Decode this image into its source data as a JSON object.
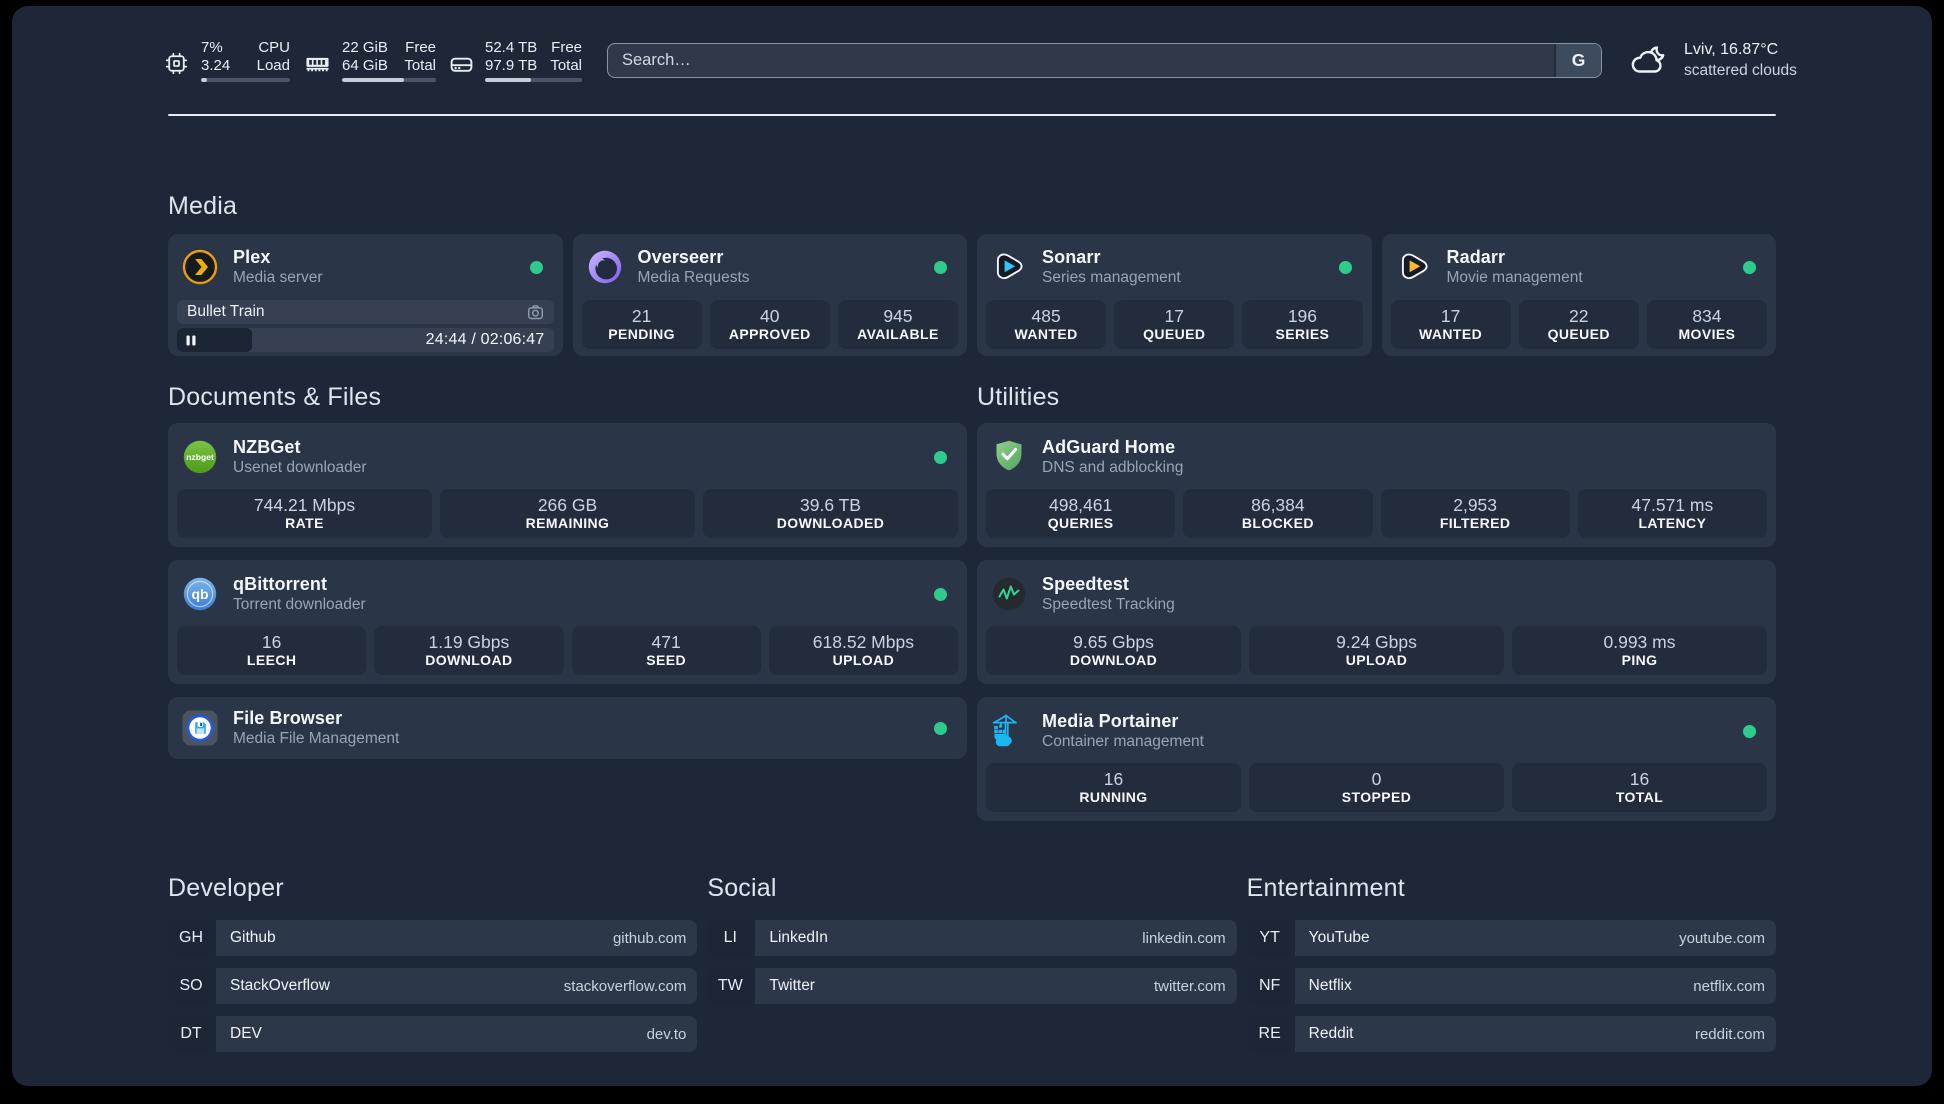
{
  "topbar": {
    "resources": [
      {
        "icon": "cpu-icon",
        "col1": [
          "7%",
          "3.24"
        ],
        "col2": [
          "CPU",
          "Load"
        ],
        "progress": 7
      },
      {
        "icon": "memory-icon",
        "col1": [
          "22 GiB",
          "64 GiB"
        ],
        "col2": [
          "Free",
          "Total"
        ],
        "progress": 66
      },
      {
        "icon": "disk-icon",
        "col1": [
          "52.4 TB",
          "97.9 TB"
        ],
        "col2": [
          "Free",
          "Total"
        ],
        "progress": 47
      }
    ],
    "search": {
      "placeholder": "Search…",
      "button": "G"
    },
    "weather": {
      "location_temp": "Lviv, 16.87°C",
      "condition": "scattered clouds"
    }
  },
  "media": {
    "title": "Media",
    "plex": {
      "title": "Plex",
      "subtitle": "Media server",
      "now_playing": "Bullet Train",
      "time": "24:44 / 02:06:47",
      "progress_pct": 20
    },
    "overseerr": {
      "title": "Overseerr",
      "subtitle": "Media Requests",
      "stats": [
        {
          "value": "21",
          "label": "PENDING"
        },
        {
          "value": "40",
          "label": "APPROVED"
        },
        {
          "value": "945",
          "label": "AVAILABLE"
        }
      ]
    },
    "sonarr": {
      "title": "Sonarr",
      "subtitle": "Series management",
      "stats": [
        {
          "value": "485",
          "label": "WANTED"
        },
        {
          "value": "17",
          "label": "QUEUED"
        },
        {
          "value": "196",
          "label": "SERIES"
        }
      ]
    },
    "radarr": {
      "title": "Radarr",
      "subtitle": "Movie management",
      "stats": [
        {
          "value": "17",
          "label": "WANTED"
        },
        {
          "value": "22",
          "label": "QUEUED"
        },
        {
          "value": "834",
          "label": "MOVIES"
        }
      ]
    }
  },
  "documents": {
    "title": "Documents & Files",
    "nzbget": {
      "title": "NZBGet",
      "subtitle": "Usenet downloader",
      "stats": [
        {
          "value": "744.21 Mbps",
          "label": "RATE"
        },
        {
          "value": "266 GB",
          "label": "REMAINING"
        },
        {
          "value": "39.6 TB",
          "label": "DOWNLOADED"
        }
      ]
    },
    "qbittorrent": {
      "title": "qBittorrent",
      "subtitle": "Torrent downloader",
      "stats": [
        {
          "value": "16",
          "label": "LEECH"
        },
        {
          "value": "1.19 Gbps",
          "label": "DOWNLOAD"
        },
        {
          "value": "471",
          "label": "SEED"
        },
        {
          "value": "618.52 Mbps",
          "label": "UPLOAD"
        }
      ]
    },
    "filebrowser": {
      "title": "File Browser",
      "subtitle": "Media File Management"
    }
  },
  "utilities": {
    "title": "Utilities",
    "adguard": {
      "title": "AdGuard Home",
      "subtitle": "DNS and adblocking",
      "stats": [
        {
          "value": "498,461",
          "label": "QUERIES"
        },
        {
          "value": "86,384",
          "label": "BLOCKED"
        },
        {
          "value": "2,953",
          "label": "FILTERED"
        },
        {
          "value": "47.571 ms",
          "label": "LATENCY"
        }
      ]
    },
    "speedtest": {
      "title": "Speedtest",
      "subtitle": "Speedtest Tracking",
      "stats": [
        {
          "value": "9.65 Gbps",
          "label": "DOWNLOAD"
        },
        {
          "value": "9.24 Gbps",
          "label": "UPLOAD"
        },
        {
          "value": "0.993 ms",
          "label": "PING"
        }
      ]
    },
    "portainer": {
      "title": "Media Portainer",
      "subtitle": "Container management",
      "stats": [
        {
          "value": "16",
          "label": "RUNNING"
        },
        {
          "value": "0",
          "label": "STOPPED"
        },
        {
          "value": "16",
          "label": "TOTAL"
        }
      ]
    }
  },
  "bookmarks": [
    {
      "title": "Developer",
      "items": [
        {
          "abbr": "GH",
          "name": "Github",
          "domain": "github.com"
        },
        {
          "abbr": "SO",
          "name": "StackOverflow",
          "domain": "stackoverflow.com"
        },
        {
          "abbr": "DT",
          "name": "DEV",
          "domain": "dev.to"
        }
      ]
    },
    {
      "title": "Social",
      "items": [
        {
          "abbr": "LI",
          "name": "LinkedIn",
          "domain": "linkedin.com"
        },
        {
          "abbr": "TW",
          "name": "Twitter",
          "domain": "twitter.com"
        }
      ]
    },
    {
      "title": "Entertainment",
      "items": [
        {
          "abbr": "YT",
          "name": "YouTube",
          "domain": "youtube.com"
        },
        {
          "abbr": "NF",
          "name": "Netflix",
          "domain": "netflix.com"
        },
        {
          "abbr": "RE",
          "name": "Reddit",
          "domain": "reddit.com"
        }
      ]
    }
  ],
  "colors": {
    "background": "#1e2738",
    "card": "#2b3548",
    "stat_block": "#222c3d",
    "status_green": "#2fcb8c",
    "divider": "#e7eaee"
  }
}
